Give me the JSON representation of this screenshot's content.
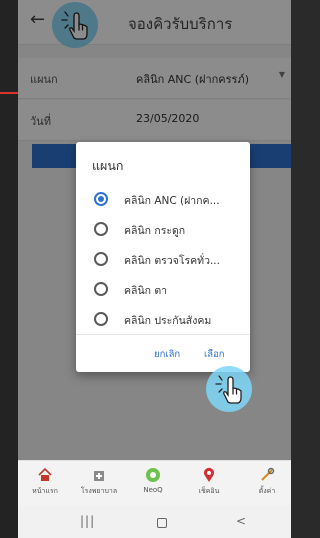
{
  "app": {
    "title": "จองคิวรับบริการ"
  },
  "form": {
    "department_label": "แผนก",
    "department_value": "คลินิก ANC (ฝากครรภ์)",
    "date_label": "วันที่",
    "date_value": "23/05/2020"
  },
  "dialog": {
    "title": "แผนก",
    "options": [
      {
        "label": "คลินิก ANC (ฝากค...",
        "selected": true
      },
      {
        "label": "คลินิก กระดูก",
        "selected": false
      },
      {
        "label": "คลินิก ตรวจโรคทั่ว...",
        "selected": false
      },
      {
        "label": "คลินิก ตา",
        "selected": false
      },
      {
        "label": "คลินิก ประกันสังคม",
        "selected": false
      }
    ],
    "cancel_label": "ยกเลิก",
    "select_label": "เลือก"
  },
  "bottom_nav": {
    "items": [
      {
        "label": "หน้าแรก",
        "icon": "home-icon"
      },
      {
        "label": "โรงพยาบาล",
        "icon": "hospital-icon"
      },
      {
        "label": "NeoQ",
        "icon": "neoq-icon"
      },
      {
        "label": "เช็คอิน",
        "icon": "location-pin-icon"
      },
      {
        "label": "ตั้งค่า",
        "icon": "settings-icon"
      }
    ]
  },
  "system_nav": {
    "recent": "|||",
    "back": "<"
  },
  "colors": {
    "accent": "#2f73d0",
    "tap_indicator": "#7ed6f7",
    "red_marker": "#d9342b"
  }
}
